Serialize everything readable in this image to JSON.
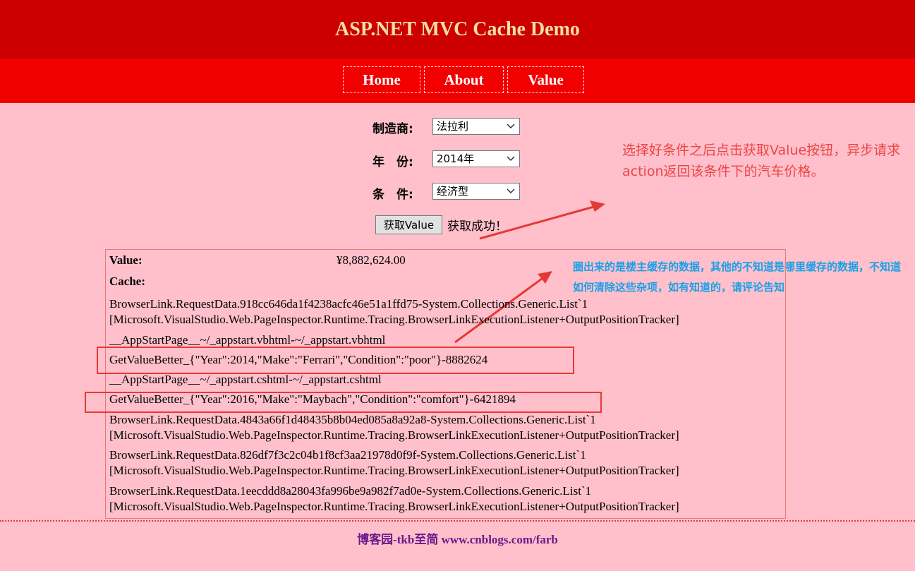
{
  "header": {
    "title": "ASP.NET MVC Cache Demo"
  },
  "nav": {
    "items": [
      "Home",
      "About",
      "Value"
    ]
  },
  "form": {
    "maker_label": "制造商:",
    "maker_value": "法拉利",
    "year_label": "年　份:",
    "year_value": "2014年",
    "condition_label": "条　件:",
    "condition_value": "经济型",
    "button_label": "获取Value",
    "status": "获取成功！"
  },
  "annotations": {
    "note1": "选择好条件之后点击获取Value按钮，异步请求action返回该条件下的汽车价格。",
    "note2": "圈出来的是楼主缓存的数据，其他的不知道是哪里缓存的数据，不知道如何清除这些杂项，如有知道的，请评论告知"
  },
  "result": {
    "value_label": "Value:",
    "value": "¥8,882,624.00",
    "cache_label": "Cache:",
    "cache_lines": [
      "BrowserLink.RequestData.918cc646da1f4238acfc46e51a1ffd75-System.Collections.Generic.List`1",
      "[Microsoft.VisualStudio.Web.PageInspector.Runtime.Tracing.BrowserLinkExecutionListener+OutputPositionTracker]",
      "__AppStartPage__~/_appstart.vbhtml-~/_appstart.vbhtml",
      "GetValueBetter_{\"Year\":2014,\"Make\":\"Ferrari\",\"Condition\":\"poor\"}-8882624",
      "__AppStartPage__~/_appstart.cshtml-~/_appstart.cshtml",
      "GetValueBetter_{\"Year\":2016,\"Make\":\"Maybach\",\"Condition\":\"comfort\"}-6421894",
      "BrowserLink.RequestData.4843a66f1d48435b8b04ed085a8a92a8-System.Collections.Generic.List`1",
      "[Microsoft.VisualStudio.Web.PageInspector.Runtime.Tracing.BrowserLinkExecutionListener+OutputPositionTracker]",
      "BrowserLink.RequestData.826df7f3c2c04b1f8cf3aa21978d0f9f-System.Collections.Generic.List`1",
      "[Microsoft.VisualStudio.Web.PageInspector.Runtime.Tracing.BrowserLinkExecutionListener+OutputPositionTracker]",
      "BrowserLink.RequestData.1eecddd8a28043fa996be9a982f7ad0e-System.Collections.Generic.List`1",
      "[Microsoft.VisualStudio.Web.PageInspector.Runtime.Tracing.BrowserLinkExecutionListener+OutputPositionTracker]"
    ]
  },
  "footer": {
    "text": "博客园-tkb至简 www.cnblogs.com/farb"
  },
  "colors": {
    "header_bg": "#cc0000",
    "nav_bg": "#f20000",
    "page_bg": "#ffc0cb",
    "annotation_red": "#ee4444",
    "annotation_blue": "#1aa0e8"
  }
}
